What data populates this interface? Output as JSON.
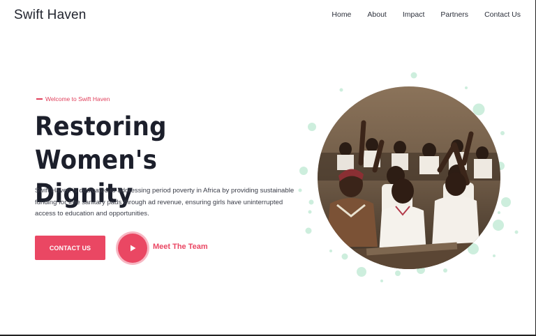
{
  "brand": {
    "name": "Swift Haven"
  },
  "nav": {
    "items": [
      "Home",
      "About",
      "Impact",
      "Partners",
      "Contact Us"
    ]
  },
  "hero": {
    "kicker": "Welcome to Swift Haven",
    "title_line1": "Restoring Women's",
    "title_line2": "Dignity",
    "description": "Swift Haven is dedicated to addressing period poverty in Africa by providing sustainable funding for free sanitary pads through ad revenue, ensuring girls have uninterrupted access to education and opportunities.",
    "cta_label": "CONTACT US",
    "secondary_label": "Meet The Team",
    "play_icon": "play-icon",
    "image_icon": "classroom-photo"
  },
  "colors": {
    "accent": "#ea4763",
    "accent_light": "#f7b7c3",
    "bubble": "#cdeedd",
    "text_dark": "#1c1f2b"
  }
}
